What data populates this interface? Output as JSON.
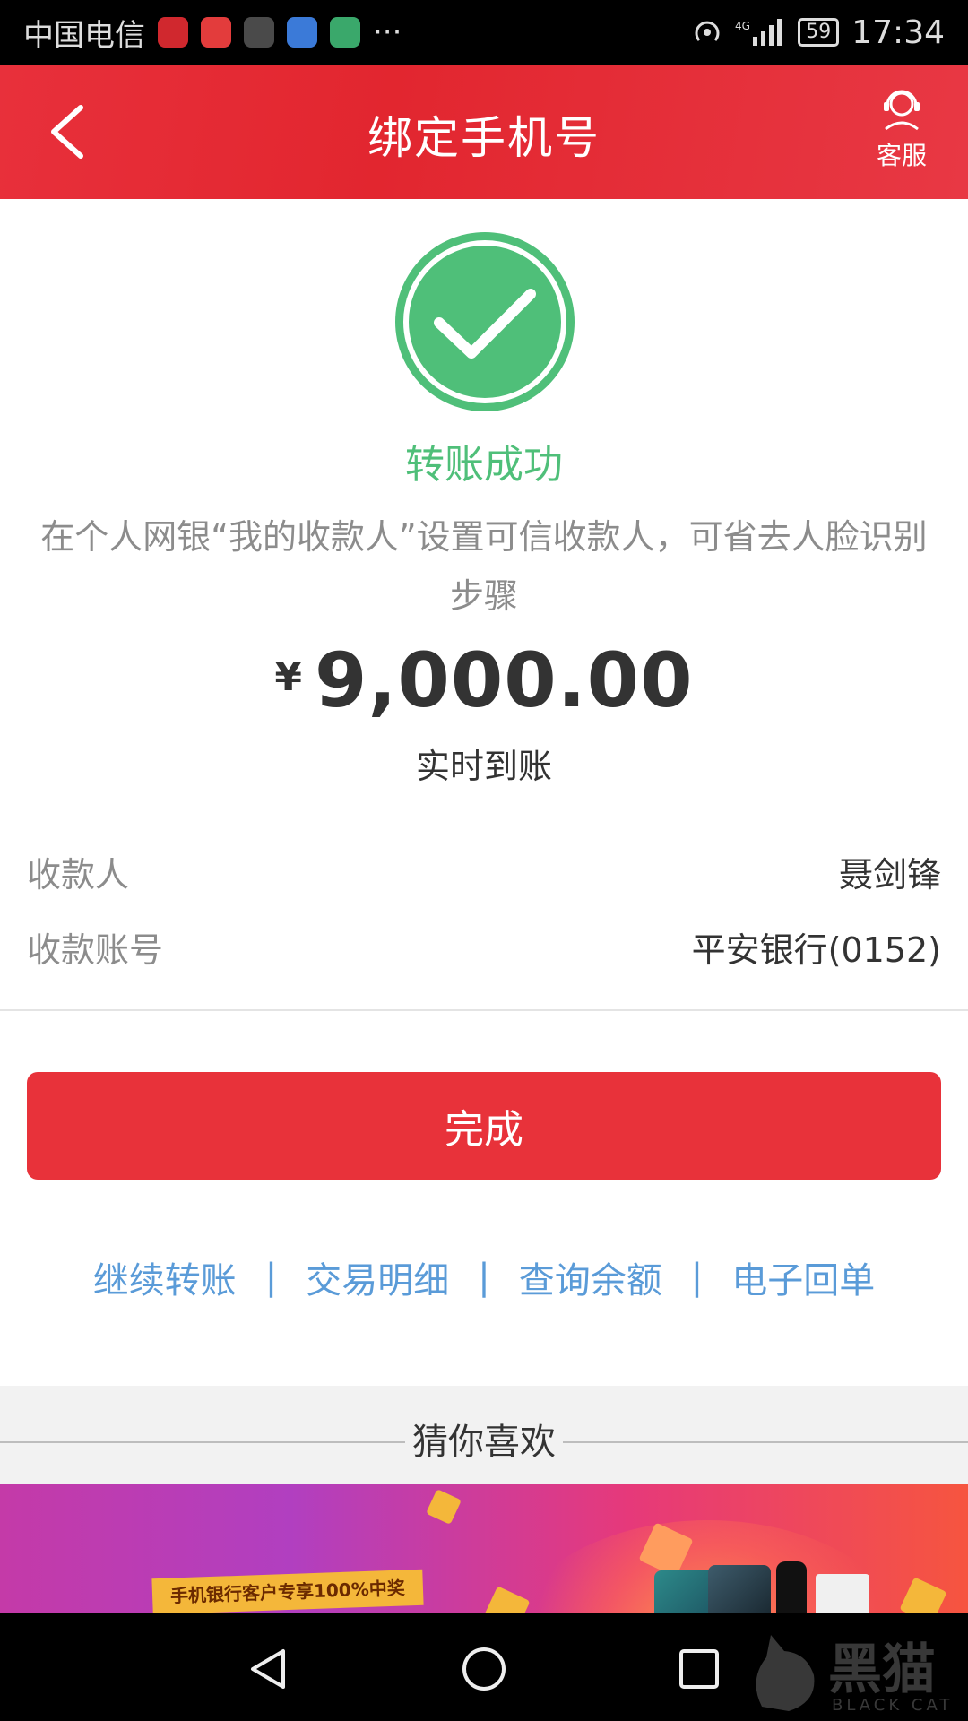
{
  "status_bar": {
    "carrier": "中国电信",
    "more": "···",
    "battery": "59",
    "time": "17:34"
  },
  "header": {
    "title": "绑定手机号",
    "customer_service_label": "客服"
  },
  "result": {
    "title": "转账成功",
    "notice": "在个人网银“我的收款人”设置可信收款人，可省去人脸识别步骤",
    "currency": "¥",
    "amount": "9,000.00",
    "arrival": "实时到账"
  },
  "details": [
    {
      "label": "收款人",
      "value": "聂剑锋"
    },
    {
      "label": "收款账号",
      "value": "平安银行(0152)"
    }
  ],
  "done_button": "完成",
  "quick_links": [
    "继续转账",
    "交易明细",
    "查询余额",
    "电子回单"
  ],
  "link_separator": "|",
  "recommend": {
    "title": "猜你喜欢",
    "banner_tag": "手机银行客户专享100%中奖"
  },
  "watermark": {
    "text": "黑猫",
    "sub": "BLACK CAT"
  },
  "colors": {
    "brand_red": "#e8323a",
    "success_green": "#4fbf79",
    "link_blue": "#5a9bd8"
  },
  "icons": {
    "back": "chevron-left-icon",
    "customer_service": "headset-icon",
    "success": "check-circle-icon"
  }
}
